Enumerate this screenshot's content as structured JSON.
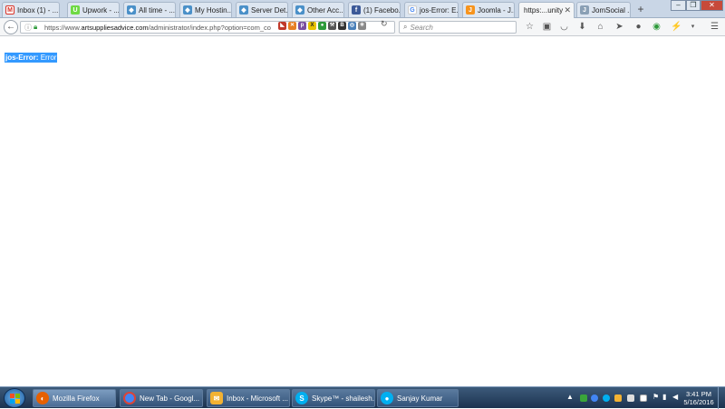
{
  "browser": {
    "tabs": [
      {
        "label": "Inbox (1) - ...",
        "fav": "gmail-icon",
        "color": "#d93025",
        "glyph": "M"
      },
      {
        "label": "Upwork - ...",
        "fav": "upwork-icon",
        "color": "#6fda44",
        "glyph": "U"
      },
      {
        "label": "All time - ...",
        "fav": "page-icon",
        "color": "#4a90c8",
        "glyph": "◆"
      },
      {
        "label": "My Hostin...",
        "fav": "page-icon",
        "color": "#4a90c8",
        "glyph": "◆"
      },
      {
        "label": "Server Det...",
        "fav": "page-icon",
        "color": "#4a90c8",
        "glyph": "◆"
      },
      {
        "label": "Other Acc...",
        "fav": "page-icon",
        "color": "#4a90c8",
        "glyph": "◆"
      },
      {
        "label": "(1) Facebo...",
        "fav": "facebook-icon",
        "color": "#3b5998",
        "glyph": "f"
      },
      {
        "label": "jos-Error: E...",
        "fav": "google-icon",
        "color": "#ffffff",
        "glyph": "G"
      },
      {
        "label": "Joomla - J...",
        "fav": "joomla-icon",
        "color": "#f7941d",
        "glyph": "J"
      },
      {
        "label": "https:...unity",
        "fav": "",
        "color": "",
        "glyph": "",
        "active": true
      },
      {
        "label": "JomSocial ...",
        "fav": "jomsocial-icon",
        "color": "#8aa0b5",
        "glyph": "J"
      }
    ],
    "new_tab": "+",
    "url_prefix": "https://www.",
    "url_domain": "artsuppliesadvice.com",
    "url_rest": "/administrator/index.php?option=com_co",
    "search_placeholder": "Search"
  },
  "page": {
    "error_label": "jos-Error:",
    "error_text": "Error"
  },
  "taskbar": {
    "items": [
      {
        "label": "Mozilla Firefox",
        "icon": "firefox-icon",
        "color": "#e66000",
        "active": true
      },
      {
        "label": "New Tab - Googl...",
        "icon": "chrome-icon",
        "color": "#4285f4"
      },
      {
        "label": "Inbox - Microsoft ...",
        "icon": "outlook-icon",
        "color": "#f2b233"
      },
      {
        "label": "Skype™ - shailesh...",
        "icon": "skype-icon",
        "color": "#00aff0"
      },
      {
        "label": "Sanjay Kumar",
        "icon": "skype-chat-icon",
        "color": "#00aff0"
      }
    ],
    "time": "3:41 PM",
    "date": "5/16/2016"
  }
}
